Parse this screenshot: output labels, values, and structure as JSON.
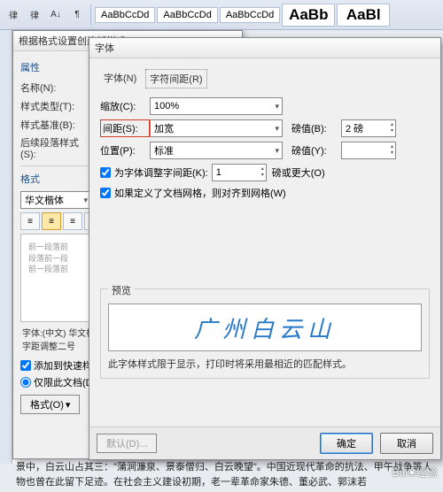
{
  "ribbon": {
    "styles": [
      "AaBbCcDd",
      "AaBbCcDd",
      "AaBbCcDd",
      "AaBb",
      "AaBl"
    ]
  },
  "dialog1": {
    "title": "根据格式设置创建新样式",
    "section_props": "属性",
    "label_name": "名称(N):",
    "label_type": "样式类型(T):",
    "label_base": "样式基准(B):",
    "label_follow": "后续段落样式(S):",
    "section_format": "格式",
    "font_name": "华文楷体",
    "preview_lines": [
      "前一段落前",
      "段落前一段",
      "前一段落前"
    ],
    "desc": "字体:(中文) 华文楷体, (默认) 宋体, 五号, 加粗, 倾斜, 字距调整二号",
    "chk_quick": "添加到快速样式列表(Q)",
    "rad_doc": "仅限此文档(D)",
    "btn_format": "格式(O)"
  },
  "dialog2": {
    "title": "字体",
    "tab_font": "字体(N)",
    "tab_spacing": "字符间距(R)",
    "lbl_scale": "缩放(C):",
    "val_scale": "100%",
    "lbl_spacing": "间距(S):",
    "val_spacing": "加宽",
    "lbl_pound1": "磅值(B):",
    "val_pound1": "2 磅",
    "lbl_position": "位置(P):",
    "val_position": "标准",
    "lbl_pound2": "磅值(Y):",
    "val_pound2": "",
    "chk_kern": "为字体调整字间距(K):",
    "val_kern": "1",
    "kern_suffix": "磅或更大(O)",
    "chk_grid": "如果定义了文档网格，则对齐到网格(W)",
    "fs_preview": "预览",
    "preview_text": "广州白云山",
    "note": "此字体样式限于显示，打印时将采用最相近的匹配样式。",
    "btn_default": "默认(D)...",
    "btn_ok": "确定",
    "btn_cancel": "取消"
  },
  "doc_text": "景中，白云山占其三：\"蒲涧濂泉、景泰僧归、白云晚望\"。中国近现代革命的抗法、甲午战争等人物也曾在此留下足迹。在社会主义建设初期，老一辈革命家朱德、董必武、郭沫若",
  "watermark": "Bai❀经验"
}
